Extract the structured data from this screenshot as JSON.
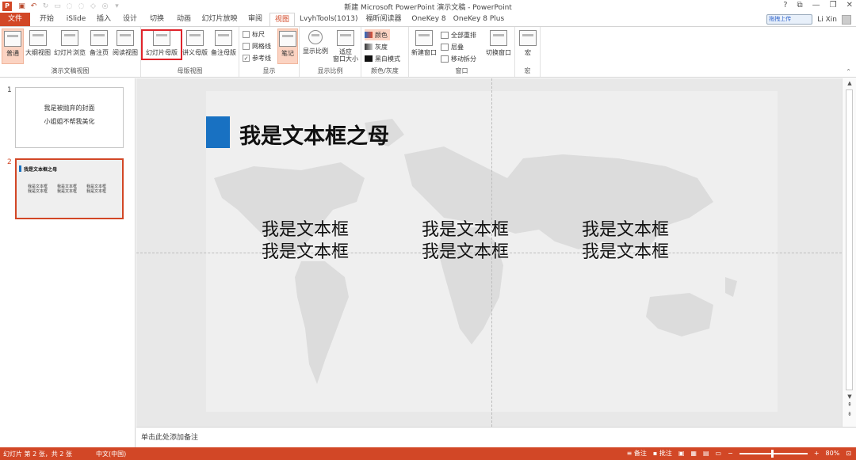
{
  "window": {
    "title": "新建 Microsoft PowerPoint 演示文稿 - PowerPoint",
    "controls": [
      "?",
      "⧉",
      "—",
      "❐",
      "✕"
    ]
  },
  "tabs": [
    {
      "label": "文件"
    },
    {
      "label": "开始"
    },
    {
      "label": "iSlide"
    },
    {
      "label": "插入"
    },
    {
      "label": "设计"
    },
    {
      "label": "切换"
    },
    {
      "label": "动画"
    },
    {
      "label": "幻灯片放映"
    },
    {
      "label": "审阅"
    },
    {
      "label": "视图"
    },
    {
      "label": "LvyhTools(1013)"
    },
    {
      "label": "福昕阅读器"
    },
    {
      "label": "OneKey 8"
    },
    {
      "label": "OneKey 8 Plus"
    }
  ],
  "user": {
    "baidu": "拖拽上传",
    "name": "Li Xin"
  },
  "ribbon": {
    "presentation_views": {
      "label": "演示文稿视图",
      "buttons": [
        "普通",
        "大纲视图",
        "幻灯片浏览",
        "备注页",
        "阅读视图"
      ]
    },
    "master_views": {
      "label": "母版视图",
      "buttons": [
        "幻灯片母版",
        "讲义母版",
        "备注母版"
      ]
    },
    "show": {
      "label": "显示",
      "ruler": "标尺",
      "gridlines": "网格线",
      "guides": "参考线",
      "notes": "笔记"
    },
    "zoom": {
      "label": "显示比例",
      "zoom": "显示比例",
      "fit": "适应",
      "fit2": "窗口大小"
    },
    "color": {
      "label": "颜色/灰度",
      "color": "颜色",
      "gray": "灰度",
      "bw": "黑白模式"
    },
    "window": {
      "label": "窗口",
      "new": "新建窗口",
      "arrange": "全部重排",
      "cascade": "层叠",
      "move": "移动拆分",
      "switch": "切换窗口"
    },
    "macro": {
      "label": "宏",
      "macro": "宏"
    }
  },
  "thumbnails": [
    {
      "num": "1",
      "line1": "我是被抛弃的封面",
      "line2": "小姐姐不帮我美化"
    },
    {
      "num": "2",
      "title": "我是文本框之母",
      "col": "我是文本框"
    }
  ],
  "slide": {
    "title": "我是文本框之母",
    "columns": [
      [
        "我是文本框",
        "我是文本框"
      ],
      [
        "我是文本框",
        "我是文本框"
      ],
      [
        "我是文本框",
        "我是文本框"
      ]
    ]
  },
  "notes": {
    "placeholder": "单击此处添加备注"
  },
  "status": {
    "slide_info": "幻灯片 第 2 张，共 2 张",
    "language": "中文(中国)",
    "notes_btn": "备注",
    "comments_btn": "批注",
    "zoom": "80%"
  },
  "colors": {
    "accent": "#d24726",
    "blue": "#1871c2"
  }
}
